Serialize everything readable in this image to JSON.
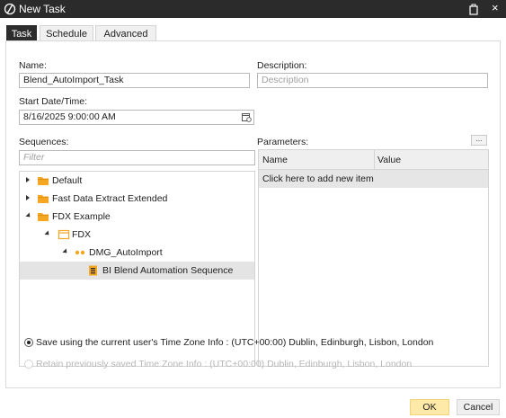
{
  "window": {
    "title": "New Task",
    "close_glyph": "×",
    "icons": [
      "app-logo-icon",
      "restore-icon",
      "close-icon"
    ]
  },
  "tabs": [
    {
      "label": "Task",
      "active": true
    },
    {
      "label": "Schedule",
      "active": false
    },
    {
      "label": "Advanced",
      "active": false
    }
  ],
  "form": {
    "name_label": "Name:",
    "name_value": "Blend_AutoImport_Task",
    "description_label": "Description:",
    "description_placeholder": "Description",
    "start_label": "Start Date/Time:",
    "start_value": "8/16/2025 9:00:00 AM",
    "sequences_label": "Sequences:",
    "filter_placeholder": "Filter",
    "parameters_label": "Parameters:",
    "parameters_button": "..."
  },
  "tree": [
    {
      "label": "Default",
      "level": 0,
      "expanded": false,
      "icon": "folder-icon"
    },
    {
      "label": "Fast Data Extract Extended",
      "level": 0,
      "expanded": false,
      "icon": "folder-icon"
    },
    {
      "label": "FDX Example",
      "level": 0,
      "expanded": true,
      "icon": "folder-icon"
    },
    {
      "label": "FDX",
      "level": 1,
      "expanded": true,
      "icon": "calendar-folder-icon"
    },
    {
      "label": "DMG_AutoImport",
      "level": 2,
      "expanded": true,
      "icon": "dots-group-icon"
    },
    {
      "label": "BI Blend Automation Sequence",
      "level": 3,
      "selected": true,
      "icon": "sequence-icon"
    }
  ],
  "parameters_grid": {
    "columns": [
      "Name",
      "Value"
    ],
    "add_row_text": "Click here to add new item"
  },
  "timezone": {
    "option1": "Save using the current user's Time Zone Info : (UTC+00:00) Dublin, Edinburgh, Lisbon, London",
    "option2": "Retain previously saved Time Zone Info : (UTC+00:00) Dublin, Edinburgh, Lisbon, London",
    "selected": 1
  },
  "buttons": {
    "ok": "OK",
    "cancel": "Cancel"
  },
  "colors": {
    "titlebar": "#2b2b2b",
    "active_tab": "#2d2d2d",
    "ok_button": "#ffe9a8",
    "folder": "#f5a623",
    "selection": "#e4e4e4"
  }
}
